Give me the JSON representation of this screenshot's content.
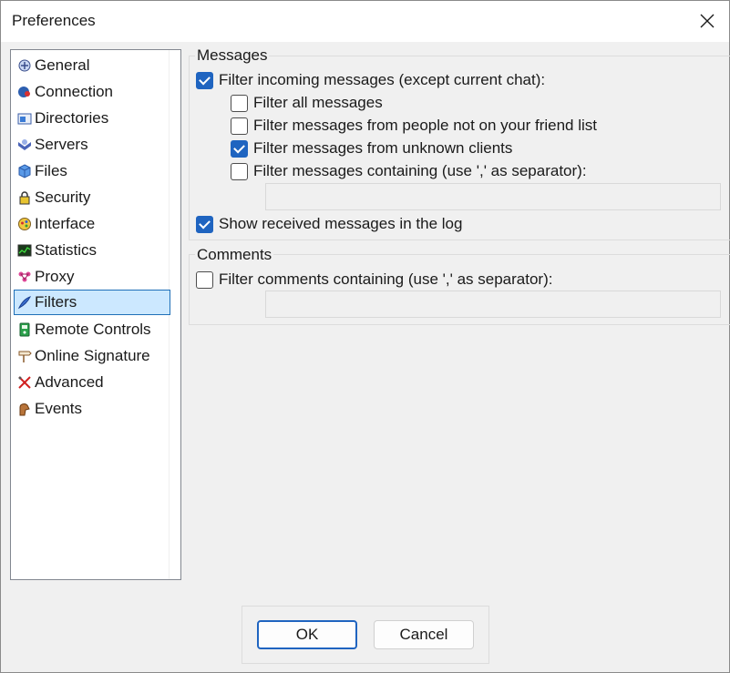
{
  "window": {
    "title": "Preferences"
  },
  "sidebar": {
    "items": [
      {
        "label": "General",
        "icon": "general-icon"
      },
      {
        "label": "Connection",
        "icon": "connection-icon"
      },
      {
        "label": "Directories",
        "icon": "directories-icon"
      },
      {
        "label": "Servers",
        "icon": "servers-icon"
      },
      {
        "label": "Files",
        "icon": "files-icon"
      },
      {
        "label": "Security",
        "icon": "lock-icon"
      },
      {
        "label": "Interface",
        "icon": "interface-icon"
      },
      {
        "label": "Statistics",
        "icon": "statistics-icon"
      },
      {
        "label": "Proxy",
        "icon": "proxy-icon"
      },
      {
        "label": "Filters",
        "icon": "filters-icon",
        "selected": true
      },
      {
        "label": "Remote Controls",
        "icon": "remote-controls-icon"
      },
      {
        "label": "Online Signature",
        "icon": "online-signature-icon"
      },
      {
        "label": "Advanced",
        "icon": "advanced-icon"
      },
      {
        "label": "Events",
        "icon": "events-icon"
      }
    ]
  },
  "messages": {
    "group_label": "Messages",
    "filter_incoming": {
      "label": "Filter incoming messages (except current chat):",
      "checked": true
    },
    "filter_all": {
      "label": "Filter all messages",
      "checked": false
    },
    "filter_not_friends": {
      "label": "Filter messages from people not on your friend list",
      "checked": false
    },
    "filter_unknown_clients": {
      "label": "Filter messages from unknown clients",
      "checked": true
    },
    "filter_containing": {
      "label": "Filter messages containing (use ',' as separator):",
      "checked": false
    },
    "filter_containing_value": "",
    "show_in_log": {
      "label": "Show received messages in the log",
      "checked": true
    }
  },
  "comments": {
    "group_label": "Comments",
    "filter_containing": {
      "label": "Filter comments containing (use ',' as separator):",
      "checked": false
    },
    "filter_containing_value": ""
  },
  "footer": {
    "ok_label": "OK",
    "cancel_label": "Cancel"
  },
  "colors": {
    "accent": "#1f64c0",
    "selection_bg": "#cce8ff",
    "selection_border": "#1f6fb8"
  }
}
